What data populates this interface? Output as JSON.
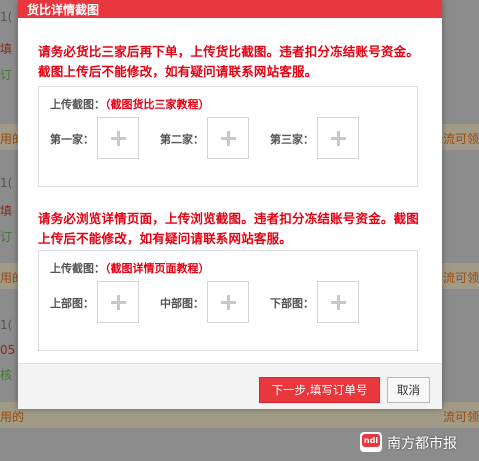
{
  "background": {
    "fragments": [
      {
        "id": "f1",
        "text": "1("
      },
      {
        "id": "f2",
        "text": "填"
      },
      {
        "id": "f3",
        "text": "订"
      },
      {
        "id": "f4",
        "text": "用的"
      },
      {
        "id": "f5",
        "text": "流可领"
      },
      {
        "id": "f6",
        "text": "1("
      },
      {
        "id": "f7",
        "text": "填"
      },
      {
        "id": "f8",
        "text": "订"
      },
      {
        "id": "f9",
        "text": "用的"
      },
      {
        "id": "f10",
        "text": "流可领"
      },
      {
        "id": "f11",
        "text": "1("
      },
      {
        "id": "f12",
        "text": "05"
      },
      {
        "id": "f13",
        "text": "核"
      },
      {
        "id": "f14",
        "text": "用的"
      },
      {
        "id": "f15",
        "text": "流可领"
      }
    ]
  },
  "modal": {
    "title": "货比详情截图",
    "notice_1": "请务必货比三家后再下单，上传货比截图。违者扣分冻结账号资金。截图上传后不能修改，如有疑问请联系网站客服。",
    "section_1": {
      "label": "上传截图：",
      "link": "（截图货比三家教程）",
      "slots": [
        "第一家：",
        "第二家：",
        "第三家："
      ]
    },
    "notice_2": "请务必浏览详情页面，上传浏览截图。违者扣分冻结账号资金。截图上传后不能修改，如有疑问请联系网站客服。",
    "section_2": {
      "label": "上传截图：",
      "link": "（截图详情页面教程）",
      "slots": [
        "上部图：",
        "中部图：",
        "下部图："
      ]
    },
    "buttons": {
      "next": "下一步,填写订单号",
      "cancel": "取消"
    }
  },
  "watermark": {
    "logo": "ndl",
    "text": "南方都市报"
  },
  "colors": {
    "accent": "#e8383d",
    "notice": "#e60012",
    "overlay": "#8c8c8c"
  },
  "icons": {
    "upload": "plus-icon"
  }
}
